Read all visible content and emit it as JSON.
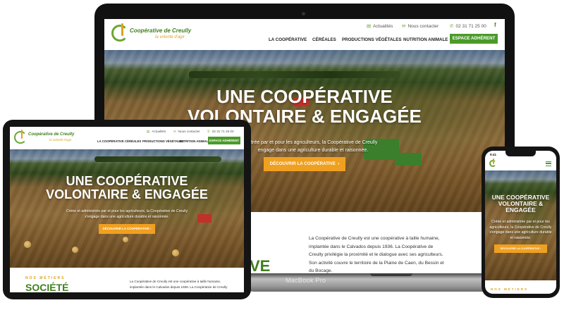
{
  "site": {
    "logo_name": "Coopérative de Creully",
    "logo_tagline": "la volonté d'agir",
    "util_links": [
      {
        "label": "Actualités",
        "icon": "newspaper-icon"
      },
      {
        "label": "Nous contacter",
        "icon": "mail-icon"
      },
      {
        "label": "02 31 71 25 00",
        "icon": "phone-icon"
      }
    ],
    "facebook": "f",
    "nav": [
      "LA COOPÉRATIVE",
      "CÉRÉALES",
      "PRODUCTIONS VÉGÉTALES",
      "NUTRITION ANIMALE"
    ],
    "nav_cta": "ESPACE ADHÉRENT",
    "hero_title_line1": "UNE COOPÉRATIVE",
    "hero_title_line2": "VOLONTAIRE & ENGAGÉE",
    "hero_sub_line1": "Créée et administrée par et pour les agriculteurs, la Coopérative de Creully",
    "hero_sub_line2": "s'engage dans une agriculture durable et raisonnée.",
    "hero_sub_laptop_line1": "strée par et pour les agriculteurs, la Coopérative de Creully",
    "hero_sub_laptop_line2": "engage dans une agriculture durable et raisonnée.",
    "hero_btn": "DÉCOUVRIR LA COOPÉRATIVE",
    "hero_btn_arrow": "›",
    "about_p": "La Coopérative de Creully est une coopérative à taille humaine, implantée dans le Calvados depuis 1936. La Coopérative de Creully privilégie la proximité et le dialogue avec ses agriculteurs. Son activité couvre le territoire de la Plaine de Caen, du Bessin et du Bocage.",
    "about_tablet_line1": "La Coopérative de Creully est une coopérative à taille humaine,",
    "about_tablet_line2": "implantée dans le Calvados depuis 1936. La Coopérative de Creully",
    "section_kicker": "NOS MÉTIERS",
    "section_big": "SOCIÉTÉ",
    "section_big_laptop": "VE"
  },
  "phone": {
    "time": "9:41",
    "hero_title_line1": "UNE COOPÉRATIVE",
    "hero_title_line2": "VOLONTAIRE &",
    "hero_title_line3": "ENGAGÉE",
    "hero_sub": "Créée et administrée par et pour les agriculteurs, la Coopérative de Creully s'engage dans une agriculture durable et raisonnée.",
    "kicker": "NOS MÉTIERS"
  },
  "device": {
    "laptop_brand": "MacBook Pro"
  },
  "colors": {
    "brand_green": "#4b9a2a",
    "accent_orange": "#f0a020",
    "logo_gold": "#e0a21a"
  }
}
